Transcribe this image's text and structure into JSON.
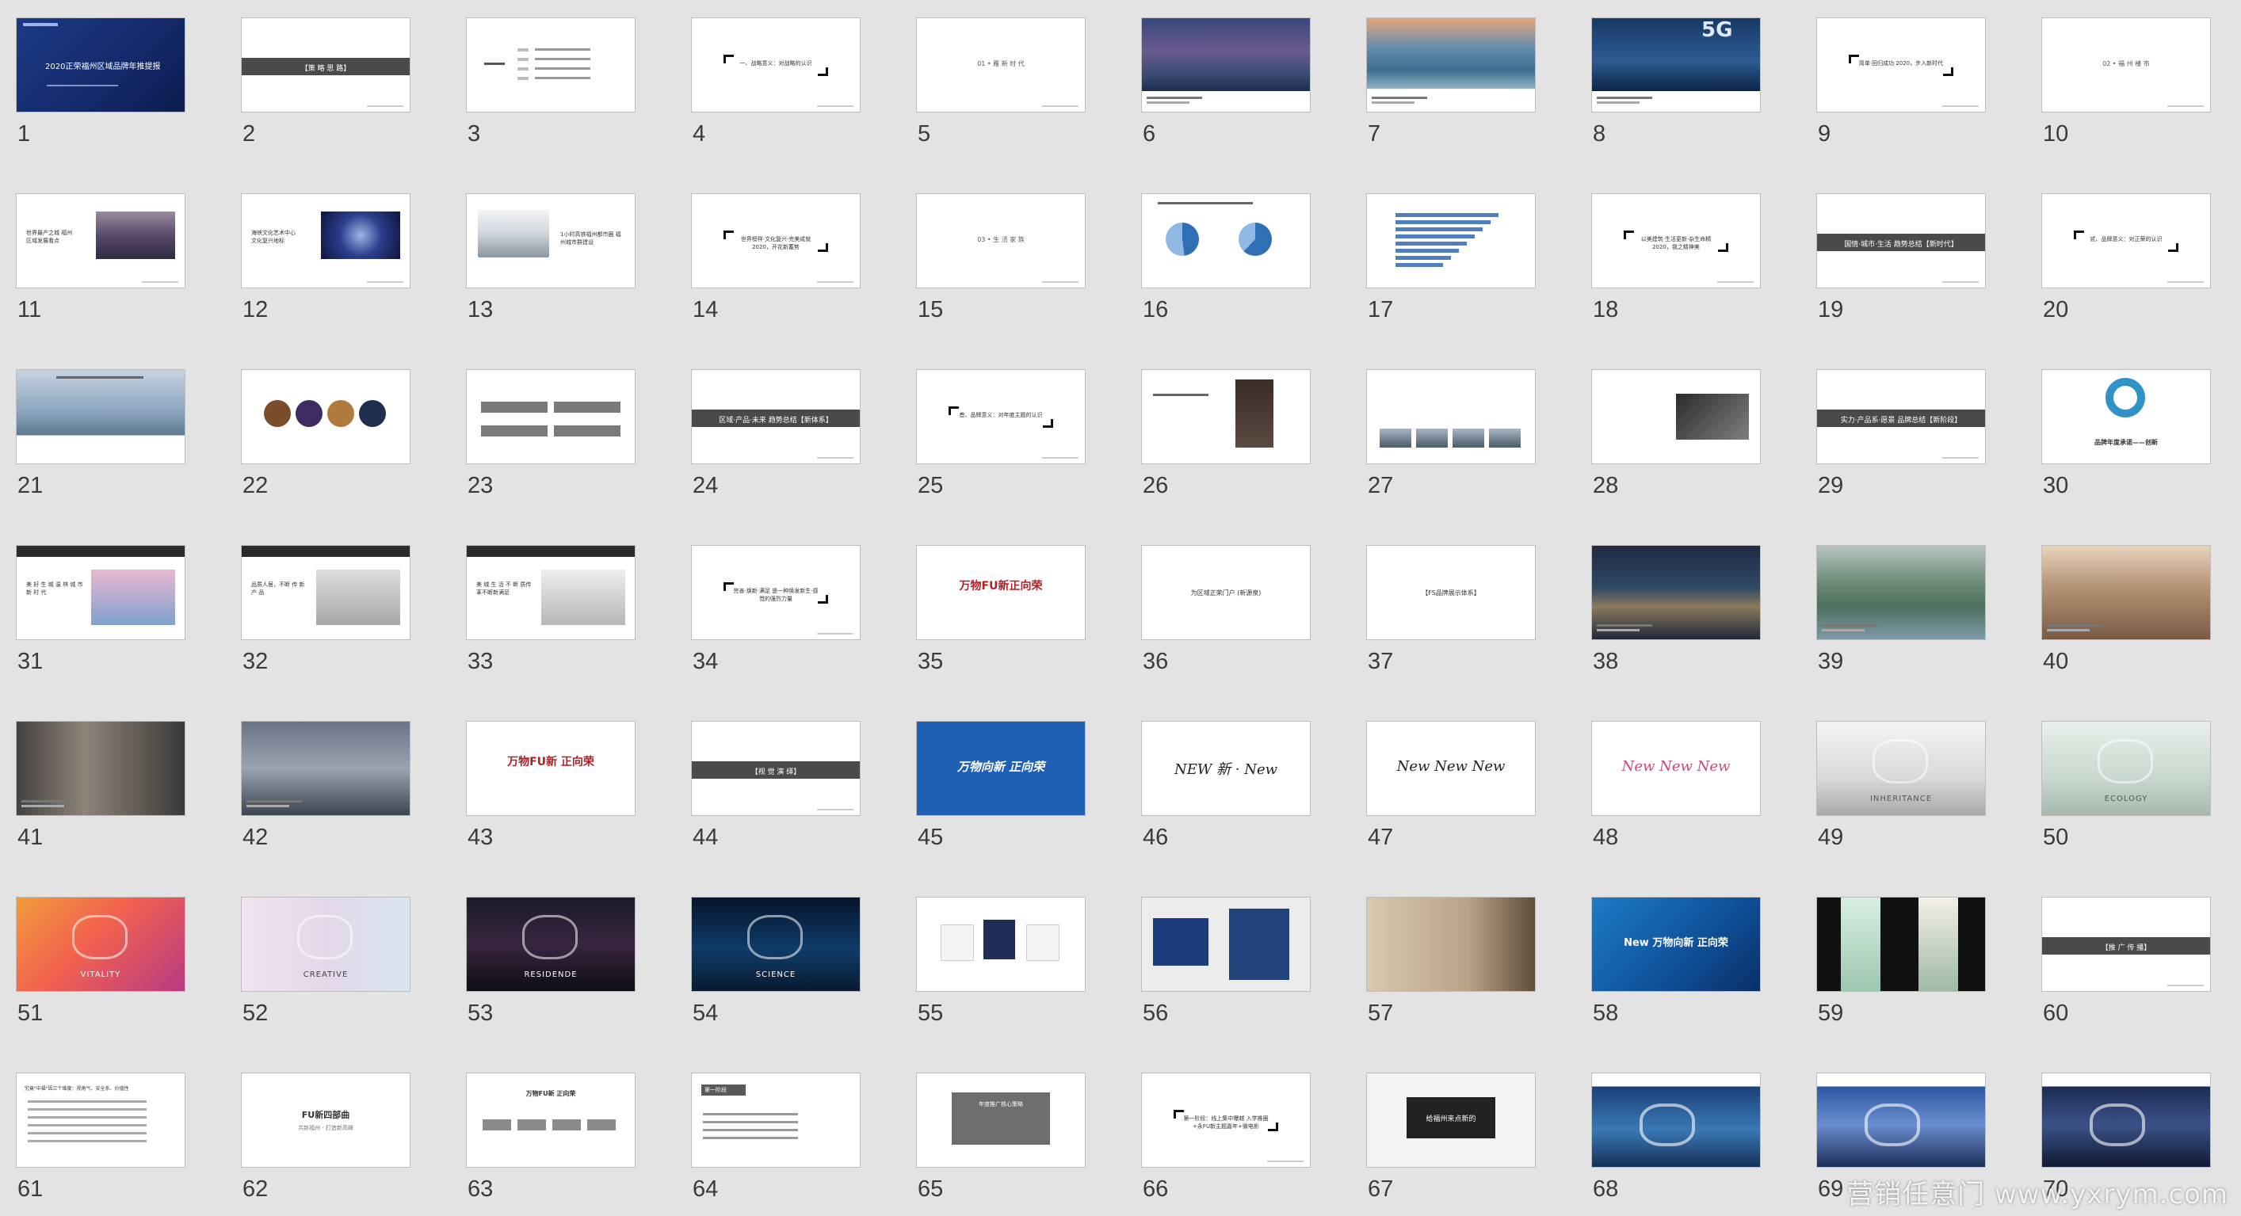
{
  "slides": [
    {
      "n": "1",
      "kind": "cover",
      "text": "2020正荣福州区域品牌年推提报"
    },
    {
      "n": "2",
      "kind": "band",
      "text": "【策 略 思 路】",
      "textColor": "#ffffff",
      "bandColor": "#4a4a4a"
    },
    {
      "n": "3",
      "kind": "tree"
    },
    {
      "n": "4",
      "kind": "bracket",
      "text": "一、战略意义：对战略的认识"
    },
    {
      "n": "5",
      "kind": "plain",
      "text": "01 • 雁 新 时 代"
    },
    {
      "n": "6",
      "kind": "photo",
      "bg": "linear-gradient(180deg,#37477c 0%,#6b5a8e 35%,#3a4c74 60%,#1c2d4c 78%,#ffffff 78%)"
    },
    {
      "n": "7",
      "kind": "photo",
      "bg": "linear-gradient(180deg,#e6a57a 0%,#6b8eae 30%,#3c6f8f 55%,#8ab0c0 75%,#ffffff 76%)"
    },
    {
      "n": "8",
      "kind": "photo5g",
      "bg": "linear-gradient(180deg,#173964 0%,#2c5c93 45%,#0e2446 78%,#ffffff 78%)",
      "text": "5G"
    },
    {
      "n": "9",
      "kind": "bracket",
      "text": "简单·回归成功 2020，步入新时代"
    },
    {
      "n": "10",
      "kind": "plain",
      "text": "02 • 福 州 楼 市"
    },
    {
      "n": "11",
      "kind": "textphoto",
      "text": "世界最产之城 福州区域发展看点",
      "bg": "linear-gradient(180deg,#9a8aa0 0%,#584a6a 50%,#2d2c40 100%)"
    },
    {
      "n": "12",
      "kind": "textphoto",
      "text": "海峡文化艺术中心 文化复兴地标",
      "bg": "radial-gradient(circle at 50% 50%,#9bb6e6 0%,#2c3e8c 45%,#0e1440 100%)"
    },
    {
      "n": "13",
      "kind": "train",
      "text": "1小时高铁福州都市圈 福州城市群建设"
    },
    {
      "n": "14",
      "kind": "bracket",
      "text": "世界榜样·文化复兴·完美成就 2020，开花新蓄势"
    },
    {
      "n": "15",
      "kind": "plain",
      "text": "03 • 生 活 家 族"
    },
    {
      "n": "16",
      "kind": "pies"
    },
    {
      "n": "17",
      "kind": "bars"
    },
    {
      "n": "18",
      "kind": "bracket",
      "text": "以美建筑·生活更新·杂生命精 2020，我之精神美"
    },
    {
      "n": "19",
      "kind": "band",
      "text": "国情·城市·生活 趋势总结【新时代】",
      "textColor": "#ffffff",
      "bandColor": "#4a4a4a"
    },
    {
      "n": "20",
      "kind": "bracket",
      "text": "贰、品牌意义：对正荣的认识"
    },
    {
      "n": "21",
      "kind": "landscape",
      "bg": "linear-gradient(180deg,#c6d4e2 0%,#8aa3bd 45%,#5d7a8f 70%,#ffffff 70%)"
    },
    {
      "n": "22",
      "kind": "circles"
    },
    {
      "n": "23",
      "kind": "grid4"
    },
    {
      "n": "24",
      "kind": "band",
      "text": "区域·产品·未来 趋势总结【新体系】",
      "textColor": "#ffffff",
      "bandColor": "#4a4a4a"
    },
    {
      "n": "25",
      "kind": "bracket",
      "text": "叁、品牌意义：对年度主题的认识"
    },
    {
      "n": "26",
      "kind": "docphoto"
    },
    {
      "n": "27",
      "kind": "thumbs"
    },
    {
      "n": "28",
      "kind": "sketch"
    },
    {
      "n": "29",
      "kind": "band",
      "text": "实力·产品系·愿景 品牌总结【新阶段】",
      "textColor": "#ffffff",
      "bandColor": "#4a4a4a"
    },
    {
      "n": "30",
      "kind": "ring",
      "text": "品牌年度承诺——创新"
    },
    {
      "n": "31",
      "kind": "topband",
      "text": "美 好 生 城 温 林 城 市 新 时 代",
      "bg": "linear-gradient(180deg,#e8b8cf 0%,#7fa0cf 100%)"
    },
    {
      "n": "32",
      "kind": "topband",
      "text": "品质人居，不断 传 新 产 品",
      "bg": "linear-gradient(180deg,#dcdcdc 0%,#a8a8a8 100%)"
    },
    {
      "n": "33",
      "kind": "topband",
      "text": "美 城 生 活 不 断 质传革不断新满足",
      "bg": "linear-gradient(180deg,#eee 0%,#b6b6b6 100%)"
    },
    {
      "n": "34",
      "kind": "bracket",
      "text": "完善·焕新·满足 是一种焕发新生·感觉的强烈力量"
    },
    {
      "n": "35",
      "kind": "redtitle",
      "text": "万物FU新正向荣"
    },
    {
      "n": "36",
      "kind": "doc2",
      "text": "为区域正荣门户 (新源泉)"
    },
    {
      "n": "37",
      "kind": "doc3",
      "text": "【FS品牌展示体系】"
    },
    {
      "n": "38",
      "kind": "photo",
      "bg": "linear-gradient(180deg,#1f2b42 0%,#2f4966 45%,#8a7a5c 65%,#202838 100%)"
    },
    {
      "n": "39",
      "kind": "photo",
      "bg": "linear-gradient(180deg,#b7c4bf 0%,#6c8a77 40%,#4d6f5e 65%,#7e9aa8 100%)"
    },
    {
      "n": "40",
      "kind": "photo",
      "bg": "linear-gradient(180deg,#e7d3bc 0%,#b39274 45%,#7a5a44 100%)"
    },
    {
      "n": "41",
      "kind": "photo",
      "bg": "linear-gradient(90deg,#43413f 0%,#8e8378 40%,#3b3a39 100%)"
    },
    {
      "n": "42",
      "kind": "photo",
      "bg": "linear-gradient(180deg,#6b7486 0%,#9aa3b0 50%,#3c4452 100%)"
    },
    {
      "n": "43",
      "kind": "redtitle",
      "text": "万物FU新 正向荣"
    },
    {
      "n": "44",
      "kind": "band",
      "text": "【视 觉 演 绎】",
      "textColor": "#ffffff",
      "bandColor": "#4a4a4a"
    },
    {
      "n": "45",
      "kind": "blueslide",
      "text": "万物向新 正向荣"
    },
    {
      "n": "46",
      "kind": "newscript",
      "text": "NEW 新 · New"
    },
    {
      "n": "47",
      "kind": "news3",
      "text": "New New New"
    },
    {
      "n": "48",
      "kind": "news3c",
      "text": "New New New"
    },
    {
      "n": "49",
      "kind": "photoword",
      "text": "INHERITANCE",
      "bg": "linear-gradient(180deg,#f4f4f4 0%,#d9d9d9 60%,#aaaaaa 100%)",
      "fg": "#555555"
    },
    {
      "n": "50",
      "kind": "photoword",
      "text": "ECOLOGY",
      "bg": "linear-gradient(180deg,#e7efe9 0%,#c9d8cf 60%,#a6b8ae 100%)",
      "fg": "#4a5a52"
    },
    {
      "n": "51",
      "kind": "photoword",
      "text": "VITALITY",
      "bg": "linear-gradient(135deg,#f29a3b 0%,#f1614f 45%,#b83a83 100%)",
      "fg": "#ffffff"
    },
    {
      "n": "52",
      "kind": "photoword",
      "text": "CREATIVE",
      "bg": "linear-gradient(90deg,#f1e3ef 0%,#e3d7ea 50%,#d9e5ef 100%)",
      "fg": "#444444"
    },
    {
      "n": "53",
      "kind": "photoword",
      "text": "RESIDENDE",
      "bg": "linear-gradient(180deg,#1a1a2a 0%,#3a2540 50%,#0d0d14 100%)",
      "fg": "#ffffff"
    },
    {
      "n": "54",
      "kind": "photoword",
      "text": "SCIENCE",
      "bg": "linear-gradient(180deg,#06142c 0%,#0f3c6a 55%,#0a1a30 100%)",
      "fg": "#ffffff"
    },
    {
      "n": "55",
      "kind": "mugs"
    },
    {
      "n": "56",
      "kind": "bags"
    },
    {
      "n": "57",
      "kind": "stationery"
    },
    {
      "n": "58",
      "kind": "bluenew",
      "text": "New 万物向新 正向荣"
    },
    {
      "n": "59",
      "kind": "posters"
    },
    {
      "n": "60",
      "kind": "band",
      "text": "【推 广 传 播】",
      "textColor": "#ffffff",
      "bandColor": "#4a4a4a"
    },
    {
      "n": "61",
      "kind": "textlines",
      "text": "究竟\"中福\"因三个维度：视角气、安全系、价值性"
    },
    {
      "n": "62",
      "kind": "quote",
      "text": "FU新四部曲",
      "sub": "共新福州 · 打造新高峰"
    },
    {
      "n": "63",
      "kind": "tree2",
      "text": "万物FU新 正向荣"
    },
    {
      "n": "64",
      "kind": "list",
      "text": "第一阶段"
    },
    {
      "n": "65",
      "kind": "greybox",
      "text": "年度推广核心策略"
    },
    {
      "n": "66",
      "kind": "bracket",
      "text": "第一阶段：线上集中曝越 入学推圈+永FU新主题嘉年+微电影"
    },
    {
      "n": "67",
      "kind": "darkbox",
      "text": "给福州来点新的"
    },
    {
      "n": "68",
      "kind": "billboard",
      "bg": "linear-gradient(180deg,#ffffff 0%,#ffffff 14%,#1b3f78 14%,#3a79b5 60%,#153058 100%)"
    },
    {
      "n": "69",
      "kind": "billboard",
      "bg": "linear-gradient(180deg,#ffffff 0%,#ffffff 14%,#2c58a2 14%,#6b8ed0 55%,#1b2e58 100%)"
    },
    {
      "n": "70",
      "kind": "billboard",
      "bg": "linear-gradient(180deg,#ffffff 0%,#ffffff 14%,#1c2b52 14%,#3b5288 55%,#121a34 100%)"
    }
  ],
  "watermark": "营销任意门 www.yxrym.com"
}
